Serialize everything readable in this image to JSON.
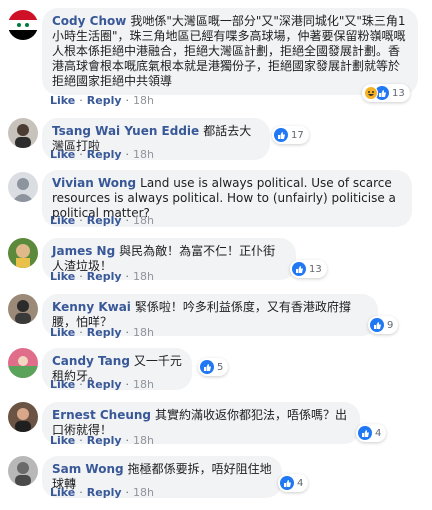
{
  "comments": [
    {
      "author": "Cody Chow",
      "text": "我哋係\"大灣區嘅一部分\"又\"深港同城化\"又\"珠三角1小時生活圈\"，珠三角地區已經有喋多高球場，仲著要保留粉嶺嘅嘅人根本係拒絕中港融合，拒絕大灣區計劃，拒絕全國發展計劃。香港高球會根本嘅底氣根本就是港獨份子，拒絕國家發展計劃就等於拒絕國家拒絕中共領導",
      "reactions": "13",
      "actions": {
        "like": "Like",
        "reply": "Reply",
        "time": "18h"
      }
    },
    {
      "author": "Tsang Wai Yuen Eddie",
      "text": "都話去大灣區打啦",
      "reactions": "17",
      "actions": {
        "like": "Like",
        "reply": "Reply",
        "time": "18h"
      }
    },
    {
      "author": "Vivian Wong",
      "text": "Land use is always political. Use of scarce resources is always political. How to (unfairly) politicise a political matter?",
      "reactions": "",
      "actions": {
        "like": "Like",
        "reply": "Reply",
        "time": "18h"
      }
    },
    {
      "author": "James Ng",
      "text": "與民為敵！為富不仁！正仆街人渣垃圾！",
      "reactions": "13",
      "actions": {
        "like": "Like",
        "reply": "Reply",
        "time": "18h"
      }
    },
    {
      "author": "Kenny Kwai",
      "text": "緊係啦！吟多利益係度，又有香港政府撐腰，怕咩？",
      "reactions": "9",
      "actions": {
        "like": "Like",
        "reply": "Reply",
        "time": "18h"
      }
    },
    {
      "author": "Candy Tang",
      "text": "又一千元租約牙。",
      "reactions": "5",
      "actions": {
        "like": "Like",
        "reply": "Reply",
        "time": "18h"
      }
    },
    {
      "author": "Ernest Cheung",
      "text": "其實約滿收返你都犯法，唔係嗎？出口術就得！",
      "reactions": "4",
      "actions": {
        "like": "Like",
        "reply": "Reply",
        "time": "18h"
      }
    },
    {
      "author": "Sam Wong",
      "text": "拖極都係要拆，唔好阻住地球轉",
      "reactions": "4",
      "actions": {
        "like": "Like",
        "reply": "Reply",
        "time": "18h"
      }
    }
  ],
  "icons": {
    "like": "like-reaction-icon",
    "haha": "haha-reaction-icon"
  },
  "colors": {
    "link": "#385898",
    "bubble": "#f2f3f5",
    "like_blue": "#2078f4",
    "haha_yellow": "#f7b125"
  }
}
